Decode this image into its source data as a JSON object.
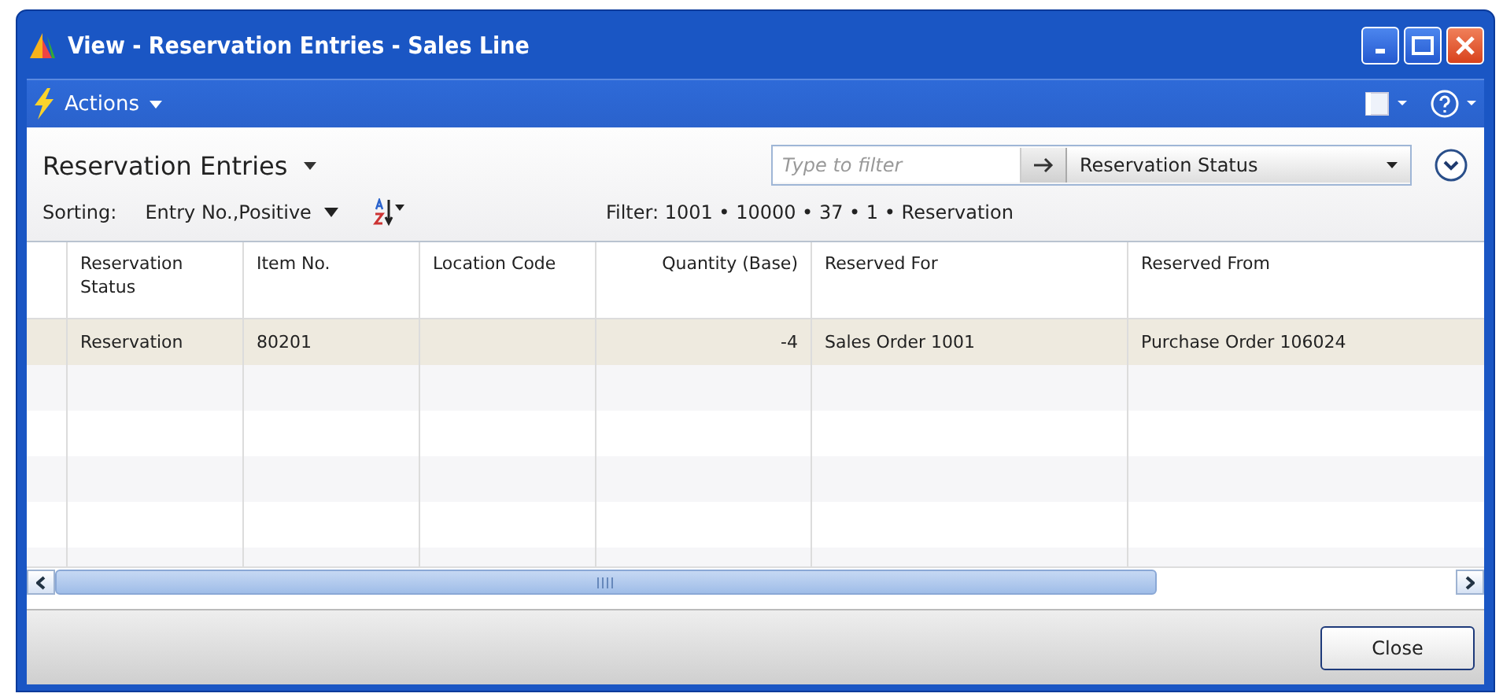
{
  "window": {
    "title": "View - Reservation Entries - Sales Line"
  },
  "action_bar": {
    "actions_label": "Actions"
  },
  "page": {
    "title": "Reservation Entries",
    "filter_field": {
      "placeholder": "Type to filter"
    },
    "filter_column": "Reservation Status",
    "sorting_label": "Sorting:",
    "sorting_value": "Entry No.,Positive",
    "filter_text": "Filter: 1001 • 10000 • 37 • 1 • Reservation"
  },
  "table": {
    "columns": [
      {
        "label": "Reservation Status",
        "kind": "text"
      },
      {
        "label": "Item No.",
        "kind": "text"
      },
      {
        "label": "Location Code",
        "kind": "text"
      },
      {
        "label": "Quantity (Base)",
        "kind": "number"
      },
      {
        "label": "Reserved For",
        "kind": "text"
      },
      {
        "label": "Reserved From",
        "kind": "text"
      }
    ],
    "rows": [
      {
        "selected": true,
        "cells": [
          "Reservation",
          "80201",
          "",
          "-4",
          "Sales Order 1001",
          "Purchase Order 106024"
        ]
      }
    ]
  },
  "buttons": [
    "Close"
  ]
}
